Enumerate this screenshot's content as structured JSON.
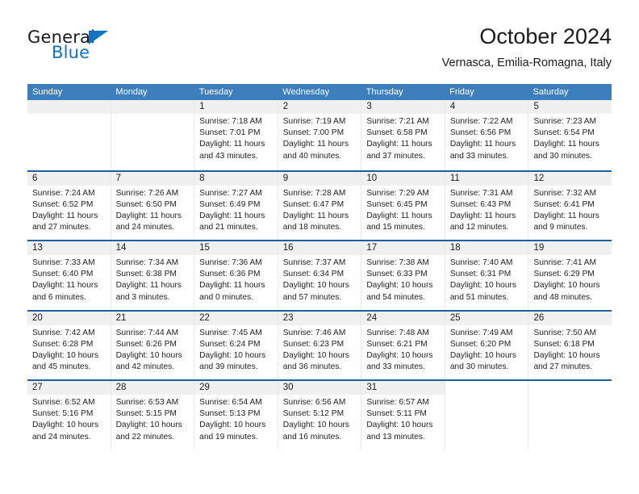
{
  "brand": {
    "name_dark": "General",
    "name_blue": "Blue",
    "accent_blue": "#1272c4"
  },
  "header": {
    "title": "October 2024",
    "subtitle": "Vernasca, Emilia-Romagna, Italy"
  },
  "colors": {
    "header_bar": "#3d7ebd",
    "row_rule": "#1f5fa0",
    "day_number_bg": "#f0f0f0",
    "cell_divider": "#e9e9e9"
  },
  "weekdays": [
    "Sunday",
    "Monday",
    "Tuesday",
    "Wednesday",
    "Thursday",
    "Friday",
    "Saturday"
  ],
  "labels": {
    "sunrise_prefix": "Sunrise: ",
    "sunset_prefix": "Sunset: ",
    "daylight_prefix": "Daylight: "
  },
  "weeks": [
    [
      {
        "day": "",
        "empty": true
      },
      {
        "day": "",
        "empty": true
      },
      {
        "day": "1",
        "sunrise": "Sunrise: 7:18 AM",
        "sunset": "Sunset: 7:01 PM",
        "daylight": "Daylight: 11 hours and 43 minutes."
      },
      {
        "day": "2",
        "sunrise": "Sunrise: 7:19 AM",
        "sunset": "Sunset: 7:00 PM",
        "daylight": "Daylight: 11 hours and 40 minutes."
      },
      {
        "day": "3",
        "sunrise": "Sunrise: 7:21 AM",
        "sunset": "Sunset: 6:58 PM",
        "daylight": "Daylight: 11 hours and 37 minutes."
      },
      {
        "day": "4",
        "sunrise": "Sunrise: 7:22 AM",
        "sunset": "Sunset: 6:56 PM",
        "daylight": "Daylight: 11 hours and 33 minutes."
      },
      {
        "day": "5",
        "sunrise": "Sunrise: 7:23 AM",
        "sunset": "Sunset: 6:54 PM",
        "daylight": "Daylight: 11 hours and 30 minutes."
      }
    ],
    [
      {
        "day": "6",
        "sunrise": "Sunrise: 7:24 AM",
        "sunset": "Sunset: 6:52 PM",
        "daylight": "Daylight: 11 hours and 27 minutes."
      },
      {
        "day": "7",
        "sunrise": "Sunrise: 7:26 AM",
        "sunset": "Sunset: 6:50 PM",
        "daylight": "Daylight: 11 hours and 24 minutes."
      },
      {
        "day": "8",
        "sunrise": "Sunrise: 7:27 AM",
        "sunset": "Sunset: 6:49 PM",
        "daylight": "Daylight: 11 hours and 21 minutes."
      },
      {
        "day": "9",
        "sunrise": "Sunrise: 7:28 AM",
        "sunset": "Sunset: 6:47 PM",
        "daylight": "Daylight: 11 hours and 18 minutes."
      },
      {
        "day": "10",
        "sunrise": "Sunrise: 7:29 AM",
        "sunset": "Sunset: 6:45 PM",
        "daylight": "Daylight: 11 hours and 15 minutes."
      },
      {
        "day": "11",
        "sunrise": "Sunrise: 7:31 AM",
        "sunset": "Sunset: 6:43 PM",
        "daylight": "Daylight: 11 hours and 12 minutes."
      },
      {
        "day": "12",
        "sunrise": "Sunrise: 7:32 AM",
        "sunset": "Sunset: 6:41 PM",
        "daylight": "Daylight: 11 hours and 9 minutes."
      }
    ],
    [
      {
        "day": "13",
        "sunrise": "Sunrise: 7:33 AM",
        "sunset": "Sunset: 6:40 PM",
        "daylight": "Daylight: 11 hours and 6 minutes."
      },
      {
        "day": "14",
        "sunrise": "Sunrise: 7:34 AM",
        "sunset": "Sunset: 6:38 PM",
        "daylight": "Daylight: 11 hours and 3 minutes."
      },
      {
        "day": "15",
        "sunrise": "Sunrise: 7:36 AM",
        "sunset": "Sunset: 6:36 PM",
        "daylight": "Daylight: 11 hours and 0 minutes."
      },
      {
        "day": "16",
        "sunrise": "Sunrise: 7:37 AM",
        "sunset": "Sunset: 6:34 PM",
        "daylight": "Daylight: 10 hours and 57 minutes."
      },
      {
        "day": "17",
        "sunrise": "Sunrise: 7:38 AM",
        "sunset": "Sunset: 6:33 PM",
        "daylight": "Daylight: 10 hours and 54 minutes."
      },
      {
        "day": "18",
        "sunrise": "Sunrise: 7:40 AM",
        "sunset": "Sunset: 6:31 PM",
        "daylight": "Daylight: 10 hours and 51 minutes."
      },
      {
        "day": "19",
        "sunrise": "Sunrise: 7:41 AM",
        "sunset": "Sunset: 6:29 PM",
        "daylight": "Daylight: 10 hours and 48 minutes."
      }
    ],
    [
      {
        "day": "20",
        "sunrise": "Sunrise: 7:42 AM",
        "sunset": "Sunset: 6:28 PM",
        "daylight": "Daylight: 10 hours and 45 minutes."
      },
      {
        "day": "21",
        "sunrise": "Sunrise: 7:44 AM",
        "sunset": "Sunset: 6:26 PM",
        "daylight": "Daylight: 10 hours and 42 minutes."
      },
      {
        "day": "22",
        "sunrise": "Sunrise: 7:45 AM",
        "sunset": "Sunset: 6:24 PM",
        "daylight": "Daylight: 10 hours and 39 minutes."
      },
      {
        "day": "23",
        "sunrise": "Sunrise: 7:46 AM",
        "sunset": "Sunset: 6:23 PM",
        "daylight": "Daylight: 10 hours and 36 minutes."
      },
      {
        "day": "24",
        "sunrise": "Sunrise: 7:48 AM",
        "sunset": "Sunset: 6:21 PM",
        "daylight": "Daylight: 10 hours and 33 minutes."
      },
      {
        "day": "25",
        "sunrise": "Sunrise: 7:49 AM",
        "sunset": "Sunset: 6:20 PM",
        "daylight": "Daylight: 10 hours and 30 minutes."
      },
      {
        "day": "26",
        "sunrise": "Sunrise: 7:50 AM",
        "sunset": "Sunset: 6:18 PM",
        "daylight": "Daylight: 10 hours and 27 minutes."
      }
    ],
    [
      {
        "day": "27",
        "sunrise": "Sunrise: 6:52 AM",
        "sunset": "Sunset: 5:16 PM",
        "daylight": "Daylight: 10 hours and 24 minutes."
      },
      {
        "day": "28",
        "sunrise": "Sunrise: 6:53 AM",
        "sunset": "Sunset: 5:15 PM",
        "daylight": "Daylight: 10 hours and 22 minutes."
      },
      {
        "day": "29",
        "sunrise": "Sunrise: 6:54 AM",
        "sunset": "Sunset: 5:13 PM",
        "daylight": "Daylight: 10 hours and 19 minutes."
      },
      {
        "day": "30",
        "sunrise": "Sunrise: 6:56 AM",
        "sunset": "Sunset: 5:12 PM",
        "daylight": "Daylight: 10 hours and 16 minutes."
      },
      {
        "day": "31",
        "sunrise": "Sunrise: 6:57 AM",
        "sunset": "Sunset: 5:11 PM",
        "daylight": "Daylight: 10 hours and 13 minutes."
      },
      {
        "day": "",
        "empty": true,
        "no_bg": true
      },
      {
        "day": "",
        "empty": true,
        "no_bg": true
      }
    ]
  ]
}
